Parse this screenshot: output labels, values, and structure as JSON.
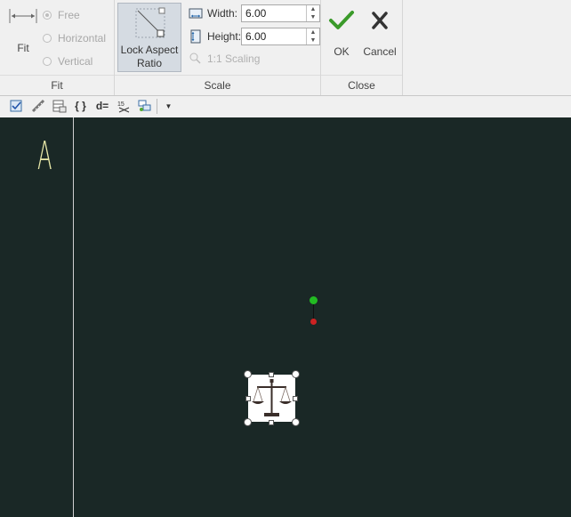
{
  "ribbon": {
    "fit_group": {
      "fit_label": "Fit",
      "options": [
        {
          "label": "Free",
          "selected": true
        },
        {
          "label": "Horizontal",
          "selected": false
        },
        {
          "label": "Vertical",
          "selected": false
        }
      ],
      "group_label": "Fit"
    },
    "scale_group": {
      "lock_label_1": "Lock Aspect",
      "lock_label_2": "Ratio",
      "width_label": "Width:",
      "width_value": "6.00",
      "height_label": "Height:",
      "height_value": "6.00",
      "scaling_label": "1:1 Scaling",
      "group_label": "Scale"
    },
    "close_group": {
      "ok_label": "OK",
      "cancel_label": "Cancel",
      "group_label": "Close"
    }
  },
  "toolbar": {
    "icons": [
      "checkbox-icon",
      "ruler-icon",
      "table-icon",
      "braces-icon",
      "d-equals-icon",
      "dimension-icon",
      "layers-icon",
      "dropdown-icon"
    ],
    "braces_text": "{ }",
    "d_equals_text": "d="
  },
  "canvas": {
    "letter": "A",
    "colors": {
      "background": "#1a2826",
      "rotate_handle": "#22bb22",
      "anchor_point": "#cc2222"
    },
    "selected_object_icon": "scales-icon"
  }
}
